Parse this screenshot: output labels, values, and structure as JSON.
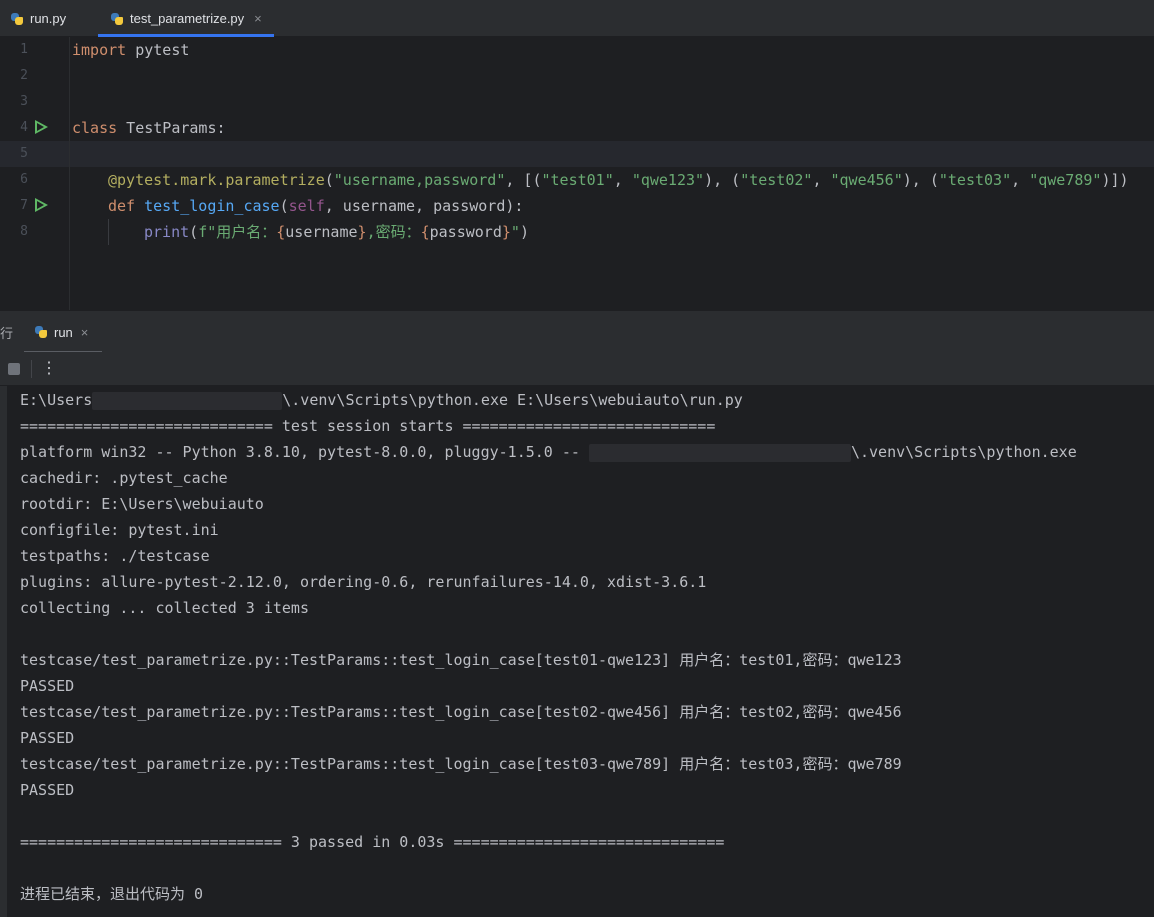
{
  "editor_tabs": [
    {
      "label": "run.py",
      "active": false,
      "icon": "python-file-icon"
    },
    {
      "label": "test_parametrize.py",
      "active": true,
      "icon": "python-file-icon",
      "close": "×"
    }
  ],
  "code": {
    "line_numbers": [
      "1",
      "2",
      "3",
      "4",
      "5",
      "6",
      "7",
      "8"
    ],
    "lines": {
      "l1": {
        "kw": "import",
        "rest": " pytest"
      },
      "l4": {
        "kw": "class",
        "rest": " TestParams:"
      },
      "l6": {
        "decorator": "@pytest.mark.parametrize",
        "open": "(",
        "s1": "\"username,password\"",
        "p1": ", [(",
        "s2": "\"test01\"",
        "p2": ", ",
        "s3": "\"qwe123\"",
        "p3": "), (",
        "s4": "\"test02\"",
        "p4": ", ",
        "s5": "\"qwe456\"",
        "p5": "), (",
        "s6": "\"test03\"",
        "p6": ", ",
        "s7": "\"qwe789\"",
        "p7": ")])"
      },
      "l7": {
        "kw": "def",
        "fn": "test_login_case",
        "open": "(",
        "self": "self",
        "rest": ", username, password):"
      },
      "l8": {
        "builtin": "print",
        "open": "(",
        "s_a": "f\"用户名：",
        "b1": "{",
        "v1": "username",
        "b2": "}",
        "s_b": ",密码：",
        "b3": "{",
        "v2": "password",
        "b4": "}",
        "s_c": "\"",
        "close": ")"
      }
    }
  },
  "run_panel": {
    "cut_glyph": "行",
    "tab_label": "run",
    "tab_close": "×",
    "toolbar": {
      "stop_icon": "stop-icon",
      "more": "⋮"
    },
    "console": {
      "l1a": "E:\\Users",
      "l1b": "\\.venv\\Scripts\\python.exe E:\\Users\\webuiauto\\run.py",
      "l2": "============================ test session starts ============================",
      "l3a": "platform win32 -- Python 3.8.10, pytest-8.0.0, pluggy-1.5.0 -- ",
      "l3b": "\\.venv\\Scripts\\python.exe",
      "l4": "cachedir: .pytest_cache",
      "l5": "rootdir: E:\\Users\\webuiauto",
      "l6": "configfile: pytest.ini",
      "l7": "testpaths: ./testcase",
      "l8": "plugins: allure-pytest-2.12.0, ordering-0.6, rerunfailures-14.0, xdist-3.6.1",
      "l9": "collecting ... collected 3 items",
      "l11": "testcase/test_parametrize.py::TestParams::test_login_case[test01-qwe123] 用户名：test01,密码：qwe123",
      "l12": "PASSED",
      "l13": "testcase/test_parametrize.py::TestParams::test_login_case[test02-qwe456] 用户名：test02,密码：qwe456",
      "l14": "PASSED",
      "l15": "testcase/test_parametrize.py::TestParams::test_login_case[test03-qwe789] 用户名：test03,密码：qwe789",
      "l16": "PASSED",
      "l18": "============================= 3 passed in 0.03s ==============================",
      "l20": "进程已结束，退出代码为 0"
    }
  },
  "colors": {
    "keyword": "#cf8e6d",
    "string": "#6aab73",
    "function": "#56a8f5",
    "decorator": "#b3ae60",
    "self": "#94558d",
    "accent": "#3574f0",
    "run_green": "#5fb865"
  }
}
